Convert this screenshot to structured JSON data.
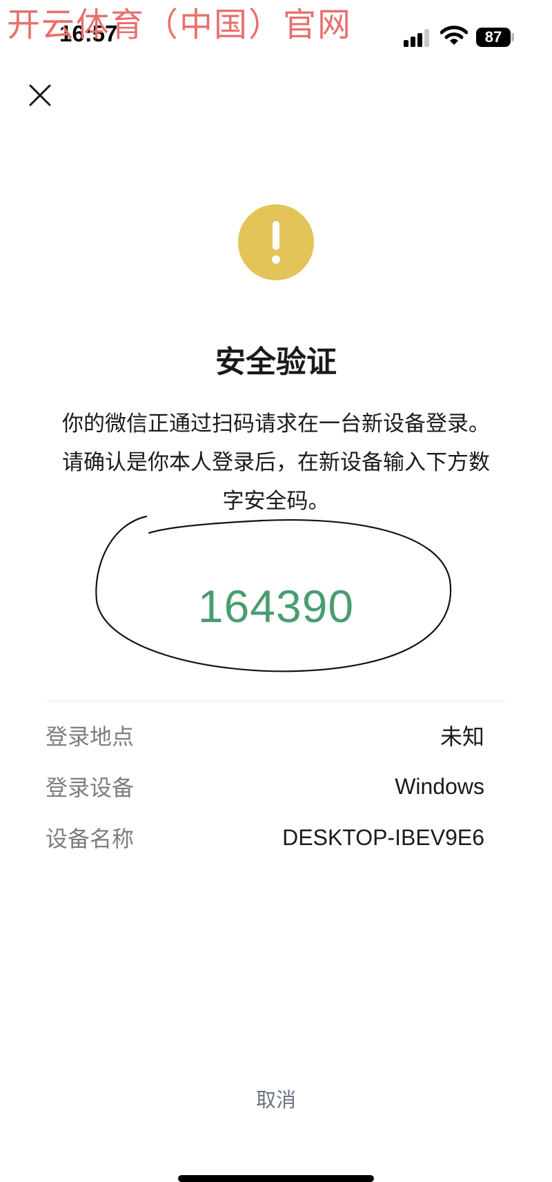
{
  "watermark": "开云体育（中国）官网",
  "status_bar": {
    "time": "16:57",
    "battery": "87"
  },
  "icons": {
    "close": "close-icon",
    "warning": "exclamation-icon"
  },
  "colors": {
    "warning_icon": "#e2c458",
    "code": "#4a9d6f",
    "cancel": "#6a7486"
  },
  "title": "安全验证",
  "description": "你的微信正通过扫码请求在一台新设备登录。请确认是你本人登录后，在新设备输入下方数字安全码。",
  "security_code": "164390",
  "info_rows": [
    {
      "label": "登录地点",
      "value": "未知"
    },
    {
      "label": "登录设备",
      "value": "Windows"
    },
    {
      "label": "设备名称",
      "value": "DESKTOP-IBEV9E6"
    }
  ],
  "cancel_label": "取消"
}
